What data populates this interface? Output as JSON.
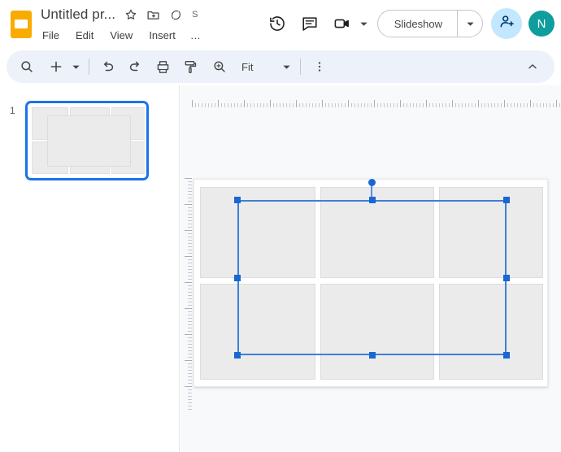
{
  "header": {
    "logo_icon": "slides-logo-icon",
    "doc_title": "Untitled pr...",
    "star_icon": "star-icon",
    "move_folder_icon": "move-to-folder-icon",
    "cloud_icon": "cloud-sync-icon",
    "save_state": "S",
    "menu": [
      "File",
      "Edit",
      "View",
      "Insert"
    ],
    "menu_overflow": "…",
    "history_icon": "version-history-icon",
    "comment_icon": "comment-icon",
    "meet_icon": "meet-camera-icon",
    "meet_caret_icon": "chevron-down-icon",
    "slideshow_label": "Slideshow",
    "slideshow_caret_icon": "chevron-down-icon",
    "share_icon": "person-add-icon",
    "avatar_initial": "N"
  },
  "toolbar": {
    "search_icon": "search-icon",
    "new_slide_icon": "plus-icon",
    "new_slide_caret_icon": "chevron-down-icon",
    "undo_icon": "undo-icon",
    "redo_icon": "redo-icon",
    "print_icon": "print-icon",
    "paint_format_icon": "paint-format-icon",
    "zoom_icon": "zoom-in-icon",
    "zoom_level": "Fit",
    "zoom_caret_icon": "chevron-down-icon",
    "more_icon": "more-vertical-icon",
    "collapse_icon": "chevron-up-icon"
  },
  "filmstrip": {
    "slide_number": "1"
  },
  "canvas": {
    "zoom_fit": "Fit",
    "selected_object": "placeholder-shape",
    "handles": 8
  },
  "colors": {
    "accent": "#1a73e8",
    "selection_border": "#3f7fd6",
    "handle": "#1967d2",
    "toolbar_bg": "#edf2fa",
    "share_bg": "#c2e7ff",
    "avatar_bg": "#0f9d9d",
    "placeholder": "#ebebeb",
    "canvas_bg": "#f8f9fa"
  }
}
